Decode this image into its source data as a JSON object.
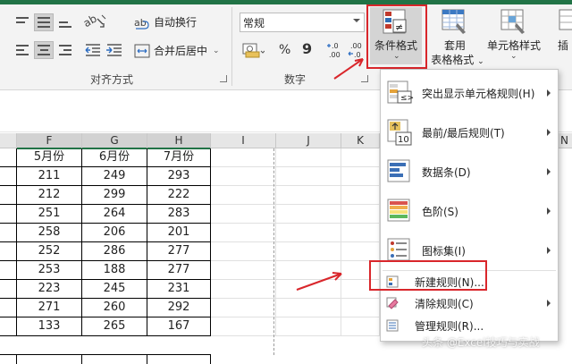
{
  "ribbon": {
    "wrap_text": "自动换行",
    "merge_center": "合并后居中",
    "alignment_group": "对齐方式",
    "number_format_value": "常规",
    "percent": "%",
    "comma": "9",
    "inc_decimal": "+.0\n.00",
    "dec_decimal": ".00\n→.0",
    "number_group": "数字",
    "conditional_format_label": "条件格式",
    "table_format_label_1": "套用",
    "table_format_label_2": "表格格式",
    "cell_style_label": "单元格样式",
    "insert_label": "插"
  },
  "sheet": {
    "columns": [
      "F",
      "G",
      "H",
      "I",
      "J",
      "K",
      "N"
    ],
    "header_row": [
      "5月份",
      "6月份",
      "7月份"
    ],
    "rows": [
      [
        "211",
        "249",
        "293"
      ],
      [
        "212",
        "299",
        "222"
      ],
      [
        "251",
        "264",
        "283"
      ],
      [
        "258",
        "206",
        "201"
      ],
      [
        "252",
        "286",
        "277"
      ],
      [
        "253",
        "188",
        "277"
      ],
      [
        "223",
        "245",
        "231"
      ],
      [
        "271",
        "260",
        "292"
      ],
      [
        "133",
        "265",
        "167"
      ]
    ]
  },
  "menu": {
    "items": [
      {
        "label": "突出显示单元格规则(H)",
        "icon": "highlight-rules-icon",
        "submenu": true
      },
      {
        "label": "最前/最后规则(T)",
        "icon": "top-bottom-rules-icon",
        "submenu": true
      },
      {
        "label": "数据条(D)",
        "icon": "data-bars-icon",
        "submenu": true
      },
      {
        "label": "色阶(S)",
        "icon": "color-scales-icon",
        "submenu": true
      },
      {
        "label": "图标集(I)",
        "icon": "icon-sets-icon",
        "submenu": true
      },
      {
        "label": "新建规则(N)...",
        "icon": "new-rule-icon",
        "submenu": false
      },
      {
        "label": "清除规则(C)",
        "icon": "clear-rules-icon",
        "submenu": true
      },
      {
        "label": "管理规则(R)...",
        "icon": "manage-rules-icon",
        "submenu": false
      }
    ],
    "top_bottom_badge": "10"
  },
  "watermark": "头条 @Excel技巧与实战",
  "colors": {
    "accent_green": "#217346",
    "highlight_red": "#d9262b"
  }
}
